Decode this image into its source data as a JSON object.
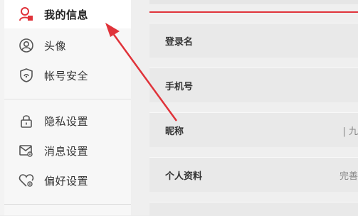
{
  "sidebar": {
    "items": [
      {
        "label": "我的信息",
        "icon": "user-profile-icon",
        "active": true
      },
      {
        "label": "头像",
        "icon": "avatar-icon",
        "active": false
      },
      {
        "label": "帐号安全",
        "icon": "shield-icon",
        "active": false
      },
      {
        "label": "隐私设置",
        "icon": "lock-icon",
        "active": false
      },
      {
        "label": "消息设置",
        "icon": "message-settings-icon",
        "active": false
      },
      {
        "label": "偏好设置",
        "icon": "heart-settings-icon",
        "active": false
      }
    ]
  },
  "main": {
    "rows": [
      {
        "label": "登录名",
        "value": ""
      },
      {
        "label": "手机号",
        "value": ""
      },
      {
        "label": "昵称",
        "value": "| 九"
      },
      {
        "label": "个人资料",
        "value": "完善"
      }
    ]
  },
  "colors": {
    "accent": "#e0333a",
    "active_icon": "#e0333a"
  }
}
